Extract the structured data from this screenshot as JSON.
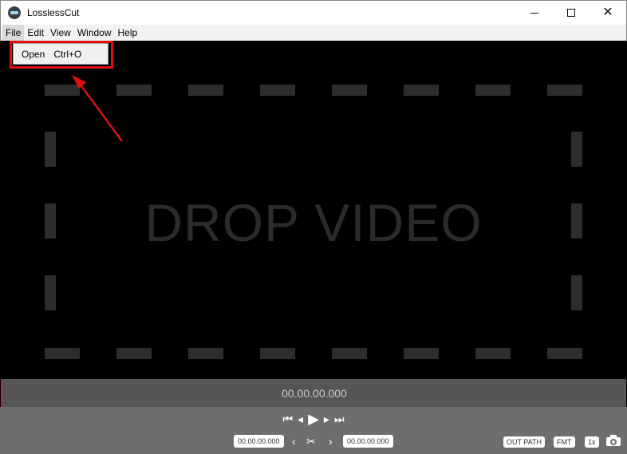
{
  "window": {
    "title": "LosslessCut",
    "minimize_label": "—",
    "close_label": "✕"
  },
  "menubar": {
    "items": [
      {
        "label": "File"
      },
      {
        "label": "Edit"
      },
      {
        "label": "View"
      },
      {
        "label": "Window"
      },
      {
        "label": "Help"
      }
    ]
  },
  "file_menu": {
    "items": [
      {
        "label": "Open",
        "shortcut": "Ctrl+O"
      }
    ]
  },
  "video": {
    "placeholder": "DROP VIDEO"
  },
  "timeline": {
    "current_time": "00.00.00.000"
  },
  "controls": {
    "cut_start": "00.00.00.000",
    "cut_end": "00.00.00.000",
    "out_path_label": "OUT PATH",
    "format_label": "FMT",
    "speed_label": "1x"
  },
  "colors": {
    "highlight": "#e01010",
    "annotation_arrow": "#e01010"
  }
}
